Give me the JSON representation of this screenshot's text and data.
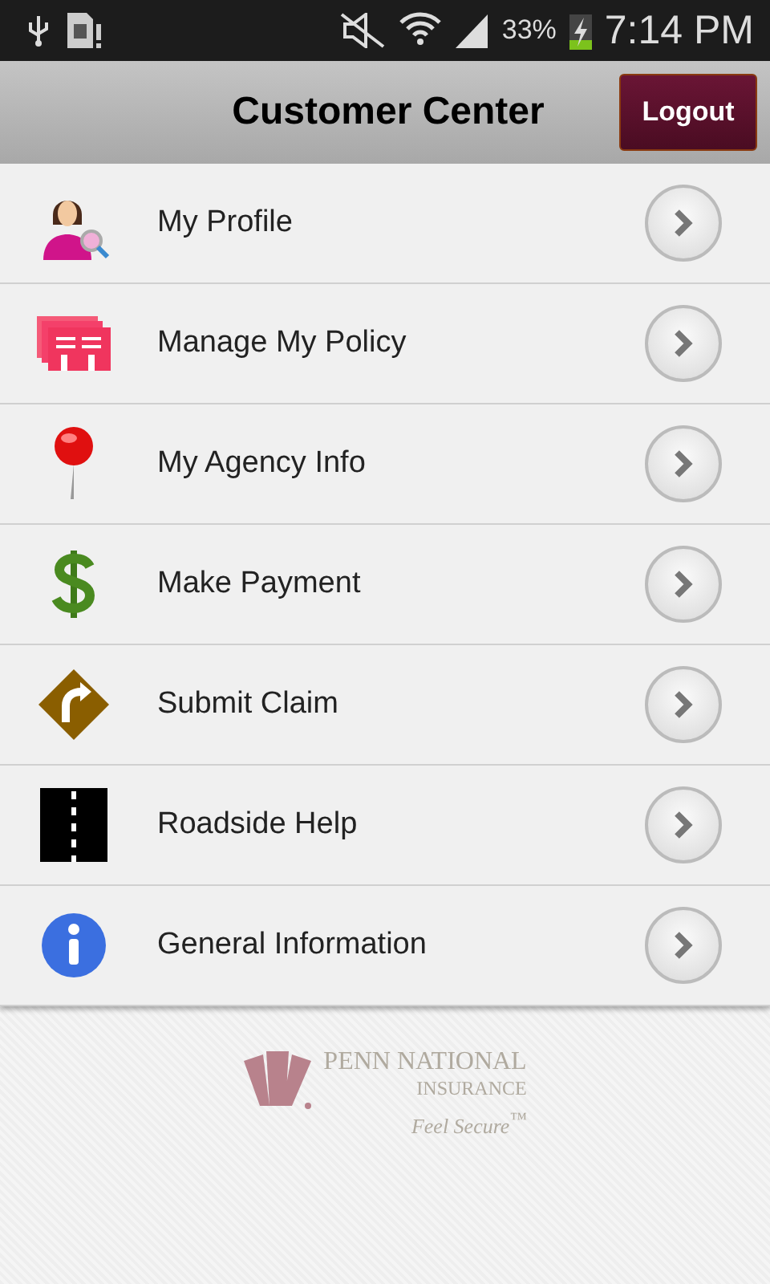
{
  "status_bar": {
    "battery": "33%",
    "time": "7:14 PM"
  },
  "header": {
    "title": "Customer Center",
    "logout": "Logout"
  },
  "menu": [
    {
      "label": "My Profile",
      "kind": "profile"
    },
    {
      "label": "Manage My Policy",
      "kind": "policy"
    },
    {
      "label": "My Agency Info",
      "kind": "pin"
    },
    {
      "label": "Make Payment",
      "kind": "dollar"
    },
    {
      "label": "Submit Claim",
      "kind": "sign"
    },
    {
      "label": "Roadside Help",
      "kind": "road"
    },
    {
      "label": "General Information",
      "kind": "info"
    }
  ],
  "logo": {
    "name": "PENN NATIONAL",
    "sub": "INSURANCE",
    "tagline": "Feel Secure$^{™}$"
  }
}
